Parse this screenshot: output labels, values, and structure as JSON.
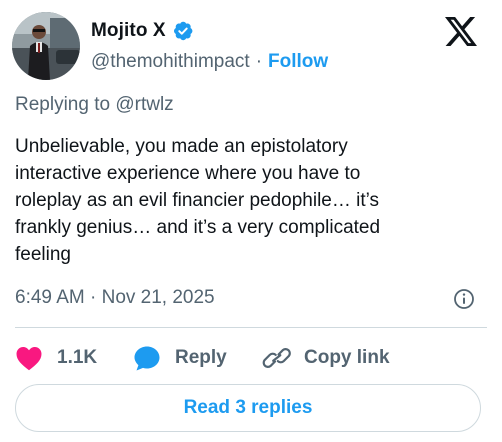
{
  "author": {
    "display_name": "Mojito X",
    "handle": "@themohithimpact",
    "separator": "·",
    "follow_label": "Follow",
    "verified": true
  },
  "reply_context": {
    "prefix": "Replying to",
    "mention": "@rtwlz"
  },
  "tweet": {
    "text_lines": [
      "Unbelievable, you made an epistolatory",
      "interactive experience where you have to",
      "roleplay as an evil financier pedophile… it’s",
      "frankly genius… and it’s a very complicated",
      "feeling"
    ],
    "timestamp": "6:49 AM · Nov 21, 2025"
  },
  "actions": {
    "like_count": "1.1K",
    "reply_label": "Reply",
    "copy_link_label": "Copy link"
  },
  "read_replies_label": "Read 3 replies",
  "icons": {
    "verified": "verified-badge-icon",
    "x_logo": "x-logo-icon",
    "info": "info-icon",
    "heart": "heart-icon",
    "reply": "speech-bubble-icon",
    "link": "link-icon"
  },
  "colors": {
    "accent": "#1d9bf0",
    "text_primary": "#0f1419",
    "text_secondary": "#536471",
    "like_red": "#f91880",
    "divider": "#cfd9de"
  }
}
